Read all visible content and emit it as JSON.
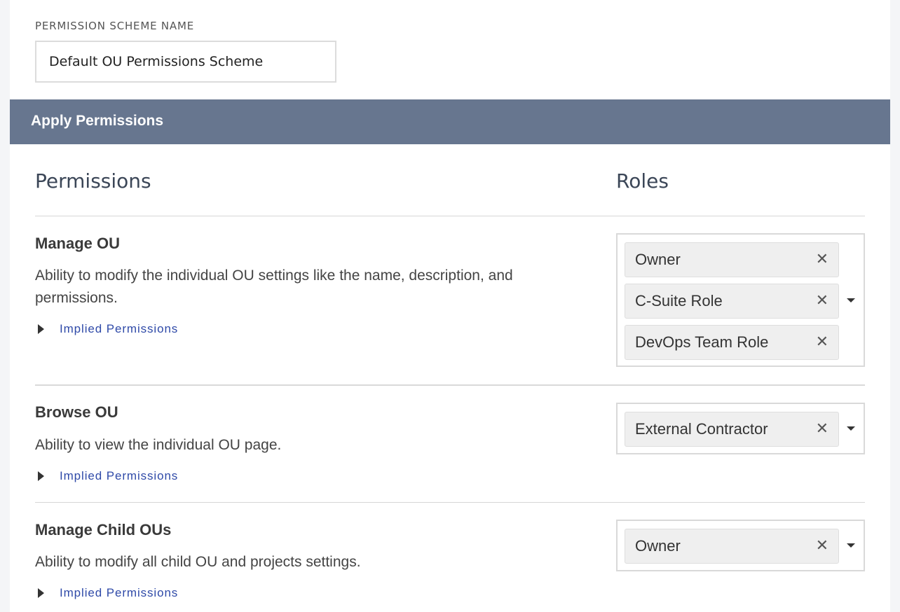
{
  "scheme": {
    "label": "PERMISSION SCHEME NAME",
    "value": "Default OU Permissions Scheme"
  },
  "section": {
    "title": "Apply Permissions"
  },
  "columns": {
    "permissions": "Permissions",
    "roles": "Roles"
  },
  "permissions": [
    {
      "title": "Manage OU",
      "description": "Ability to modify the individual OU settings like the name, description, and permissions.",
      "implied_label": "Implied Permissions",
      "roles": [
        "Owner",
        "C-Suite Role",
        "DevOps Team Role"
      ]
    },
    {
      "title": "Browse OU",
      "description": "Ability to view the individual OU page.",
      "implied_label": "Implied Permissions",
      "roles": [
        "External Contractor"
      ]
    },
    {
      "title": "Manage Child OUs",
      "description": "Ability to modify all child OU and projects settings.",
      "implied_label": "Implied Permissions",
      "roles": [
        "Owner"
      ]
    }
  ],
  "icons": {
    "remove": "close-icon",
    "expand": "caret-right-icon",
    "dropdown": "chevron-down-icon"
  },
  "colors": {
    "section_bar": "#67768f",
    "link": "#2f4aa8",
    "chip_bg": "#efefef"
  }
}
